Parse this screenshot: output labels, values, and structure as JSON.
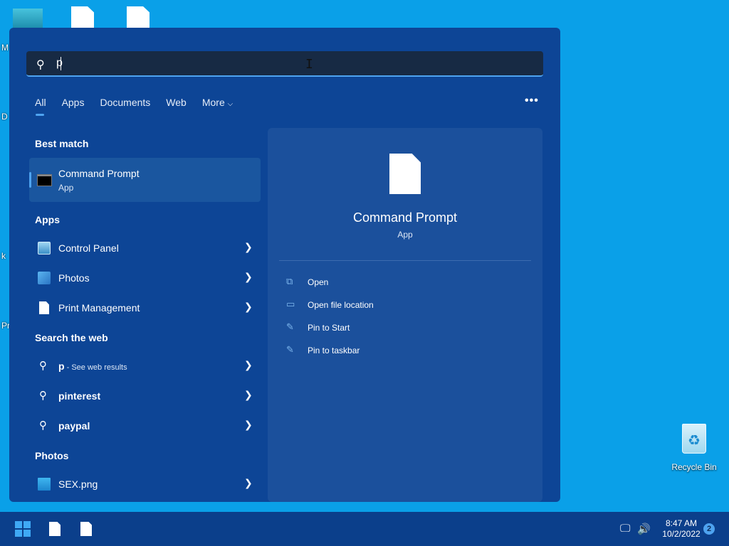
{
  "desktop": {
    "edge_letters": [
      "M",
      "D",
      "k",
      "Pr"
    ],
    "recycle_bin_label": "Recycle Bin"
  },
  "search": {
    "query": "p",
    "search_icon": "search-icon"
  },
  "tabs": [
    {
      "label": "All",
      "active": true
    },
    {
      "label": "Apps",
      "active": false
    },
    {
      "label": "Documents",
      "active": false
    },
    {
      "label": "Web",
      "active": false
    },
    {
      "label": "More",
      "active": false
    }
  ],
  "more_dots": "•••",
  "sections": {
    "best_match": "Best match",
    "apps": "Apps",
    "search_web": "Search the web",
    "photos": "Photos"
  },
  "best_match": {
    "name": "Command Prompt",
    "type": "App"
  },
  "apps": [
    {
      "label": "Control Panel",
      "icon": "control-panel-icon"
    },
    {
      "label": "Photos",
      "icon": "photos-icon"
    },
    {
      "label": "Print Management",
      "icon": "document-icon"
    }
  ],
  "web": [
    {
      "label": "p",
      "suffix": " - See web results"
    },
    {
      "label": "pinterest",
      "suffix": ""
    },
    {
      "label": "paypal",
      "suffix": ""
    }
  ],
  "photos": [
    {
      "label": "SEX.png",
      "icon": "image-file-icon"
    }
  ],
  "preview": {
    "title": "Command Prompt",
    "type": "App",
    "actions": [
      {
        "label": "Open",
        "icon": "open-icon"
      },
      {
        "label": "Open file location",
        "icon": "folder-icon"
      },
      {
        "label": "Pin to Start",
        "icon": "pin-icon"
      },
      {
        "label": "Pin to taskbar",
        "icon": "pin-icon"
      }
    ]
  },
  "taskbar": {
    "time": "8:47 AM",
    "date": "10/2/2022",
    "notification_count": "2"
  },
  "colors": {
    "desktop": "#0aa0e8",
    "panel": "#0d4596",
    "accent": "#4ea3f0",
    "taskbar": "#0b3f8b"
  }
}
